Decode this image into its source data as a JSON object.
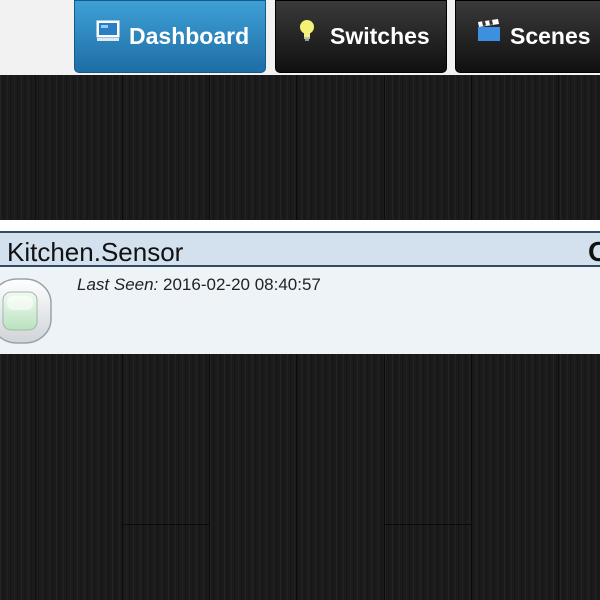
{
  "nav": {
    "tabs": [
      {
        "label": "Dashboard",
        "icon": "dashboard-monitor-icon",
        "active": true
      },
      {
        "label": "Switches",
        "icon": "lightbulb-icon",
        "active": false
      },
      {
        "label": "Scenes",
        "icon": "clapperboard-icon",
        "active": false
      }
    ]
  },
  "device": {
    "name": "Kitchen.Sensor",
    "status": "O",
    "last_seen_label": "Last Seen:",
    "last_seen_value": "2016-02-20 08:40:57",
    "icon": "motion-sensor-icon"
  },
  "colors": {
    "active_tab": "#2a85c0",
    "inactive_tab": "#222222",
    "panel_header": "#d3e1ef",
    "panel_body": "#eef3f8",
    "background": "#1b1b1b"
  }
}
